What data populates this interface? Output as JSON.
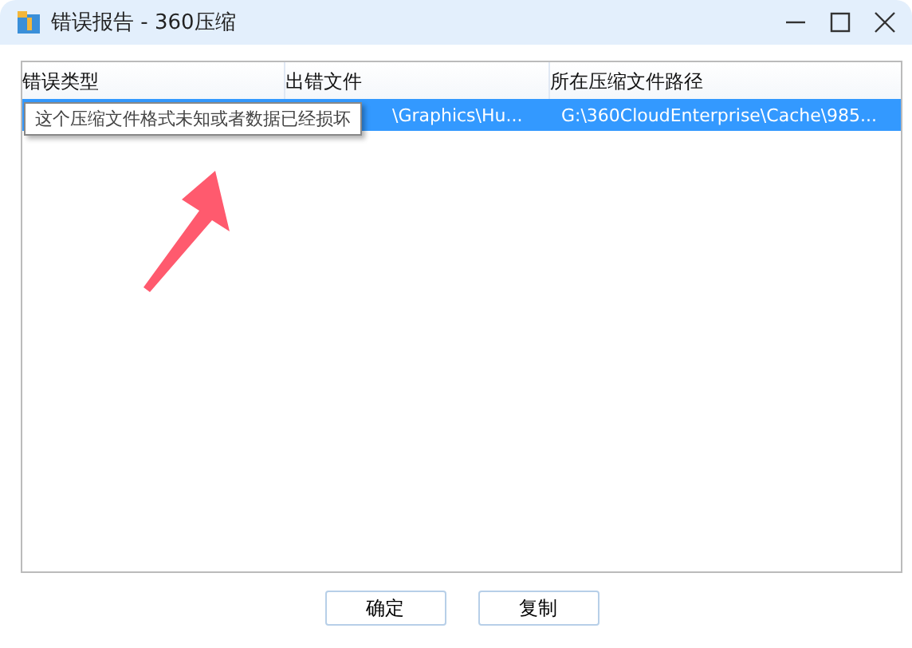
{
  "window": {
    "title": "错误报告 - 360压缩"
  },
  "table": {
    "columns": [
      "错误类型",
      "出错文件",
      "所在压缩文件路径"
    ],
    "rows": [
      {
        "selected": true,
        "cells": [
          "",
          "\\Graphics\\Hu...",
          "G:\\360CloudEnterprise\\Cache\\985..."
        ]
      }
    ]
  },
  "tooltip": {
    "text": "这个压缩文件格式未知或者数据已经损坏"
  },
  "buttons": [
    "确定",
    "复制"
  ]
}
